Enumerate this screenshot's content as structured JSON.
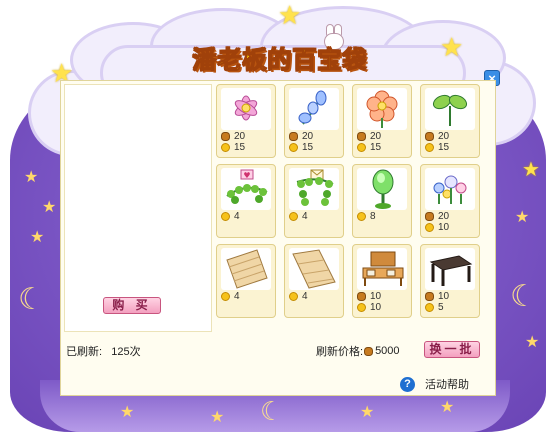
{
  "window": {
    "title": "潘老板的百宝袋",
    "close_glyph": "×"
  },
  "buy_button": {
    "label": "购 买"
  },
  "status": {
    "refreshed_label": "已刷新:",
    "refreshed_count": "125次",
    "refresh_price_label": "刷新价格:",
    "refresh_price_value": "5000",
    "refresh_price_icon": "bean-icon"
  },
  "refresh_button": {
    "label": "换一批"
  },
  "help": {
    "icon": "?",
    "label": "活动帮助"
  },
  "items": [
    {
      "name": "pink-flower",
      "bean": "20",
      "gold": "15"
    },
    {
      "name": "blue-flower",
      "bean": "20",
      "gold": "15"
    },
    {
      "name": "orange-flower",
      "bean": "20",
      "gold": "15"
    },
    {
      "name": "green-sprout",
      "bean": "20",
      "gold": "15"
    },
    {
      "name": "ivy-heart-sign",
      "gold": "4"
    },
    {
      "name": "ivy-letter-sign",
      "gold": "4"
    },
    {
      "name": "green-lamp",
      "gold": "8"
    },
    {
      "name": "flower-cluster",
      "bean": "20",
      "gold": "10"
    },
    {
      "name": "wood-panel-a",
      "gold": "4"
    },
    {
      "name": "wood-panel-b",
      "gold": "4"
    },
    {
      "name": "wooden-bench-set",
      "bean": "10",
      "gold": "10"
    },
    {
      "name": "dark-table",
      "bean": "10",
      "gold": "5"
    }
  ],
  "colors": {
    "bag_purple": "#7a55c4",
    "title_yellow": "#ffd400",
    "button_pink": "#f3a0bf",
    "panel_cream": "#fffdf0",
    "close_blue": "#3a8ee6"
  }
}
